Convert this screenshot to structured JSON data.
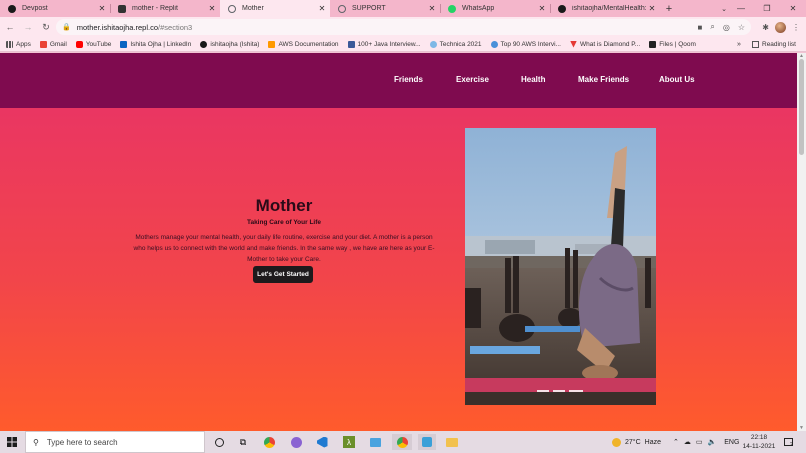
{
  "browser": {
    "tabs": [
      {
        "label": "Devpost",
        "favicon_color": "#1a1a1a",
        "active": false
      },
      {
        "label": "mother - Replit",
        "favicon_color": "#333333",
        "active": false
      },
      {
        "label": "Mother",
        "favicon_color": "#5f6368",
        "active": true
      },
      {
        "label": "SUPPORT",
        "favicon_color": "#5f6368",
        "active": false
      },
      {
        "label": "WhatsApp",
        "favicon_color": "#25d366",
        "active": false
      },
      {
        "label": "ishitaojha/MentalHealth: Pa",
        "favicon_color": "#1a1a1a",
        "active": false
      }
    ],
    "new_tab_glyph": "+",
    "url_host": "mother.ishitaojha.repl.co",
    "url_path": "/#section3",
    "bookmarks": [
      {
        "label": "Apps",
        "icon_color": "#4285f4"
      },
      {
        "label": "Gmail",
        "icon_color": "#ea4335"
      },
      {
        "label": "YouTube",
        "icon_color": "#ff0000"
      },
      {
        "label": "Ishita Ojha | LinkedIn",
        "icon_color": "#0a66c2"
      },
      {
        "label": "ishitaojha (Ishita)",
        "icon_color": "#1a1a1a"
      },
      {
        "label": "AWS Documentation",
        "icon_color": "#ff9900"
      },
      {
        "label": "100+ Java Interview...",
        "icon_color": "#3b5998"
      },
      {
        "label": "Technica 2021",
        "icon_color": "#7fb8e6"
      },
      {
        "label": "Top 90 AWS Intervi...",
        "icon_color": "#4a90d9"
      },
      {
        "label": "What is Diamond P...",
        "icon_color": "#e53935"
      },
      {
        "label": "Files | Qoom",
        "icon_color": "#222222"
      }
    ],
    "bookmarks_more": "»",
    "reading_list": "Reading list"
  },
  "page": {
    "nav": [
      "Friends",
      "Exercise",
      "Health",
      "Make Friends",
      "About Us"
    ],
    "hero": {
      "title": "Mother",
      "subtitle": "Taking Care of Your Life",
      "line1": "Mothers manage your mental health, your daily life routine, exercise and your diet. A mother is a person",
      "line2": "who helps us to connect with the world and make friends. In the same way , we have are here as your E-",
      "line3": "Mother to take your Care.",
      "cta": "Let's Get Started"
    },
    "colors": {
      "navbar": "#7f0b4f",
      "gradient_top": "#e7316a",
      "gradient_bottom": "#ff5b2c"
    }
  },
  "taskbar": {
    "search_placeholder": "Type here to search",
    "weather_temp": "27°C",
    "weather_text": "Haze",
    "language": "ENG",
    "time": "22:18",
    "date": "14-11-2021",
    "notification_count": "2"
  }
}
